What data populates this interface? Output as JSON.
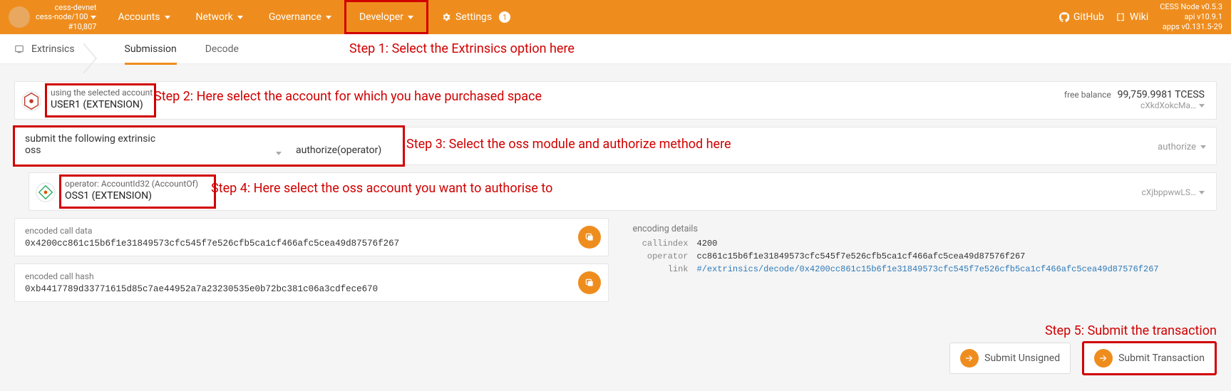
{
  "topbar": {
    "node_name": "cess-devnet",
    "node_sub": "cess-node/100",
    "node_block": "#10,807",
    "nav": {
      "accounts": "Accounts",
      "network": "Network",
      "governance": "Governance",
      "developer": "Developer",
      "settings": "Settings",
      "settings_badge": "1"
    },
    "github": "GitHub",
    "wiki": "Wiki",
    "ver1": "CESS Node v0.5.3",
    "ver2": "api v10.9.1",
    "ver3": "apps v0.131.5-29"
  },
  "subnav": {
    "section": "Extrinsics",
    "tab_submission": "Submission",
    "tab_decode": "Decode"
  },
  "steps": {
    "s1": "Step 1: Select the Extrinsics option here",
    "s2": "Step 2: Here select the account for which you have purchased space",
    "s3": "Step 3: Select the oss module and authorize method here",
    "s4": "Step 4: Here select the oss account you want to authorise to",
    "s5": "Step 5: Submit the transaction"
  },
  "account": {
    "label": "using the selected account",
    "value": "USER1 (EXTENSION)",
    "free_label": "free balance",
    "free_value": "99,759.9981 TCESS",
    "addr_short": "cXkdXokcMa…"
  },
  "extrinsic": {
    "label": "submit the following extrinsic",
    "module": "oss",
    "method": "authorize(operator)",
    "method_name": "authorize"
  },
  "operator": {
    "label": "operator: AccountId32 (AccountOf)",
    "value": "OSS1 (EXTENSION)",
    "addr_short": "cXjbppwwLS…"
  },
  "calldata": {
    "label": "encoded call data",
    "value": "0x4200cc861c15b6f1e31849573cfc545f7e526cfb5ca1cf466afc5cea49d87576f267"
  },
  "callhash": {
    "label": "encoded call hash",
    "value": "0xb4417789d33771615d85c7ae44952a7a23230535e0b72bc381c06a3cdfece670"
  },
  "encoding": {
    "label": "encoding details",
    "k_callindex": "callindex",
    "v_callindex": "4200",
    "k_operator": "operator",
    "v_operator": "cc861c15b6f1e31849573cfc545f7e526cfb5ca1cf466afc5cea49d87576f267",
    "k_link": "link",
    "v_link": "#/extrinsics/decode/0x4200cc861c15b6f1e31849573cfc545f7e526cfb5ca1cf466afc5cea49d87576f267"
  },
  "buttons": {
    "unsigned": "Submit Unsigned",
    "signed": "Submit Transaction"
  }
}
